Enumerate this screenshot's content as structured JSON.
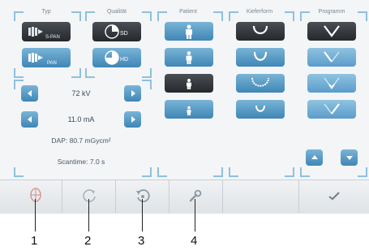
{
  "panels": {
    "typ": {
      "label": "Typ",
      "buttons": [
        {
          "label": "S-PAN"
        },
        {
          "label": "PAN"
        }
      ]
    },
    "qualitaet": {
      "label": "Qualität",
      "buttons": [
        {
          "label": "SD"
        },
        {
          "label": "HD"
        }
      ]
    },
    "patient": {
      "label": "Patient"
    },
    "kieferform": {
      "label": "Kieferform"
    },
    "programm": {
      "label": "Programm"
    }
  },
  "exposure": {
    "kv": "72 kV",
    "ma": "11.0 mA",
    "dap": "DAP: 80.7 mGycm²",
    "scantime": "Scantime: 7.0 s"
  },
  "callouts": [
    "1",
    "2",
    "3",
    "4"
  ],
  "colors": {
    "accent": "#8fc0df",
    "button_dark": "#2b2f33",
    "button_blue": "#4f93c2"
  }
}
